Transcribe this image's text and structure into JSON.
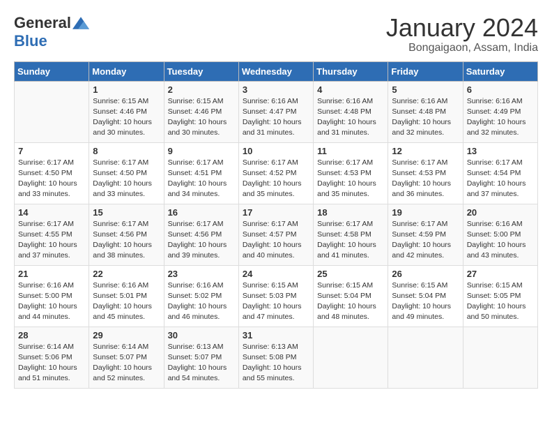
{
  "header": {
    "logo_general": "General",
    "logo_blue": "Blue",
    "month_title": "January 2024",
    "location": "Bongaigaon, Assam, India"
  },
  "days_of_week": [
    "Sunday",
    "Monday",
    "Tuesday",
    "Wednesday",
    "Thursday",
    "Friday",
    "Saturday"
  ],
  "weeks": [
    [
      {
        "day": "",
        "sunrise": "",
        "sunset": "",
        "daylight": ""
      },
      {
        "day": "1",
        "sunrise": "Sunrise: 6:15 AM",
        "sunset": "Sunset: 4:46 PM",
        "daylight": "Daylight: 10 hours and 30 minutes."
      },
      {
        "day": "2",
        "sunrise": "Sunrise: 6:15 AM",
        "sunset": "Sunset: 4:46 PM",
        "daylight": "Daylight: 10 hours and 30 minutes."
      },
      {
        "day": "3",
        "sunrise": "Sunrise: 6:16 AM",
        "sunset": "Sunset: 4:47 PM",
        "daylight": "Daylight: 10 hours and 31 minutes."
      },
      {
        "day": "4",
        "sunrise": "Sunrise: 6:16 AM",
        "sunset": "Sunset: 4:48 PM",
        "daylight": "Daylight: 10 hours and 31 minutes."
      },
      {
        "day": "5",
        "sunrise": "Sunrise: 6:16 AM",
        "sunset": "Sunset: 4:48 PM",
        "daylight": "Daylight: 10 hours and 32 minutes."
      },
      {
        "day": "6",
        "sunrise": "Sunrise: 6:16 AM",
        "sunset": "Sunset: 4:49 PM",
        "daylight": "Daylight: 10 hours and 32 minutes."
      }
    ],
    [
      {
        "day": "7",
        "sunrise": "Sunrise: 6:17 AM",
        "sunset": "Sunset: 4:50 PM",
        "daylight": "Daylight: 10 hours and 33 minutes."
      },
      {
        "day": "8",
        "sunrise": "Sunrise: 6:17 AM",
        "sunset": "Sunset: 4:50 PM",
        "daylight": "Daylight: 10 hours and 33 minutes."
      },
      {
        "day": "9",
        "sunrise": "Sunrise: 6:17 AM",
        "sunset": "Sunset: 4:51 PM",
        "daylight": "Daylight: 10 hours and 34 minutes."
      },
      {
        "day": "10",
        "sunrise": "Sunrise: 6:17 AM",
        "sunset": "Sunset: 4:52 PM",
        "daylight": "Daylight: 10 hours and 35 minutes."
      },
      {
        "day": "11",
        "sunrise": "Sunrise: 6:17 AM",
        "sunset": "Sunset: 4:53 PM",
        "daylight": "Daylight: 10 hours and 35 minutes."
      },
      {
        "day": "12",
        "sunrise": "Sunrise: 6:17 AM",
        "sunset": "Sunset: 4:53 PM",
        "daylight": "Daylight: 10 hours and 36 minutes."
      },
      {
        "day": "13",
        "sunrise": "Sunrise: 6:17 AM",
        "sunset": "Sunset: 4:54 PM",
        "daylight": "Daylight: 10 hours and 37 minutes."
      }
    ],
    [
      {
        "day": "14",
        "sunrise": "Sunrise: 6:17 AM",
        "sunset": "Sunset: 4:55 PM",
        "daylight": "Daylight: 10 hours and 37 minutes."
      },
      {
        "day": "15",
        "sunrise": "Sunrise: 6:17 AM",
        "sunset": "Sunset: 4:56 PM",
        "daylight": "Daylight: 10 hours and 38 minutes."
      },
      {
        "day": "16",
        "sunrise": "Sunrise: 6:17 AM",
        "sunset": "Sunset: 4:56 PM",
        "daylight": "Daylight: 10 hours and 39 minutes."
      },
      {
        "day": "17",
        "sunrise": "Sunrise: 6:17 AM",
        "sunset": "Sunset: 4:57 PM",
        "daylight": "Daylight: 10 hours and 40 minutes."
      },
      {
        "day": "18",
        "sunrise": "Sunrise: 6:17 AM",
        "sunset": "Sunset: 4:58 PM",
        "daylight": "Daylight: 10 hours and 41 minutes."
      },
      {
        "day": "19",
        "sunrise": "Sunrise: 6:17 AM",
        "sunset": "Sunset: 4:59 PM",
        "daylight": "Daylight: 10 hours and 42 minutes."
      },
      {
        "day": "20",
        "sunrise": "Sunrise: 6:16 AM",
        "sunset": "Sunset: 5:00 PM",
        "daylight": "Daylight: 10 hours and 43 minutes."
      }
    ],
    [
      {
        "day": "21",
        "sunrise": "Sunrise: 6:16 AM",
        "sunset": "Sunset: 5:00 PM",
        "daylight": "Daylight: 10 hours and 44 minutes."
      },
      {
        "day": "22",
        "sunrise": "Sunrise: 6:16 AM",
        "sunset": "Sunset: 5:01 PM",
        "daylight": "Daylight: 10 hours and 45 minutes."
      },
      {
        "day": "23",
        "sunrise": "Sunrise: 6:16 AM",
        "sunset": "Sunset: 5:02 PM",
        "daylight": "Daylight: 10 hours and 46 minutes."
      },
      {
        "day": "24",
        "sunrise": "Sunrise: 6:15 AM",
        "sunset": "Sunset: 5:03 PM",
        "daylight": "Daylight: 10 hours and 47 minutes."
      },
      {
        "day": "25",
        "sunrise": "Sunrise: 6:15 AM",
        "sunset": "Sunset: 5:04 PM",
        "daylight": "Daylight: 10 hours and 48 minutes."
      },
      {
        "day": "26",
        "sunrise": "Sunrise: 6:15 AM",
        "sunset": "Sunset: 5:04 PM",
        "daylight": "Daylight: 10 hours and 49 minutes."
      },
      {
        "day": "27",
        "sunrise": "Sunrise: 6:15 AM",
        "sunset": "Sunset: 5:05 PM",
        "daylight": "Daylight: 10 hours and 50 minutes."
      }
    ],
    [
      {
        "day": "28",
        "sunrise": "Sunrise: 6:14 AM",
        "sunset": "Sunset: 5:06 PM",
        "daylight": "Daylight: 10 hours and 51 minutes."
      },
      {
        "day": "29",
        "sunrise": "Sunrise: 6:14 AM",
        "sunset": "Sunset: 5:07 PM",
        "daylight": "Daylight: 10 hours and 52 minutes."
      },
      {
        "day": "30",
        "sunrise": "Sunrise: 6:13 AM",
        "sunset": "Sunset: 5:07 PM",
        "daylight": "Daylight: 10 hours and 54 minutes."
      },
      {
        "day": "31",
        "sunrise": "Sunrise: 6:13 AM",
        "sunset": "Sunset: 5:08 PM",
        "daylight": "Daylight: 10 hours and 55 minutes."
      },
      {
        "day": "",
        "sunrise": "",
        "sunset": "",
        "daylight": ""
      },
      {
        "day": "",
        "sunrise": "",
        "sunset": "",
        "daylight": ""
      },
      {
        "day": "",
        "sunrise": "",
        "sunset": "",
        "daylight": ""
      }
    ]
  ]
}
